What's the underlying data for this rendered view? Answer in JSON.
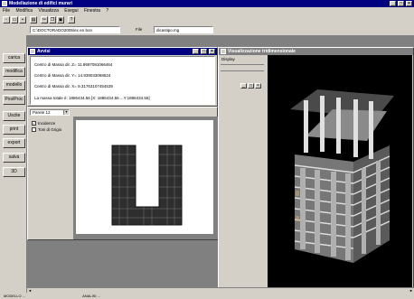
{
  "app": {
    "title": "Modellazione  di edifici murari",
    "menu": [
      "File",
      "Modifica",
      "Visualizza",
      "Esegui",
      "Finestra",
      "?"
    ]
  },
  "toolbar_icons": [
    "new-icon",
    "open-icon",
    "save-icon",
    "print-icon",
    "cut-icon",
    "copy-icon",
    "paste-icon",
    "info-icon"
  ],
  "pathbar": {
    "path_value": "C:\\DOCTORADO2005\\ex en bon",
    "file_label": "File",
    "file_value": "dicastipo.mg"
  },
  "sidebar": {
    "buttons": [
      "carica",
      "modifica",
      "modello",
      "PostProc",
      "Uscite",
      "print",
      "export",
      "salva",
      "3D"
    ]
  },
  "avvisi": {
    "title": "Avvisi",
    "lines": [
      "Centro di Massa dir. Z= 11.8697081066464",
      "Centro di Massa dir. Y= 14.939033068524",
      "Centro di Massa dir. X= 9.31763107454539",
      "La massa totale è: 1886434.56   [X: 1886434.56 ...Y:1886434.56]"
    ]
  },
  "view3d": {
    "title": "Visualizzazione tridimensionale",
    "display_label": "Display"
  },
  "plan": {
    "dropdown_value": "Parete 12",
    "checkboxes": [
      {
        "label": "Incidenze",
        "checked": true
      },
      {
        "label": "Toni di Grigio",
        "checked": false
      }
    ]
  },
  "statusbar": {
    "items": [
      "MODELLO ...",
      "ANALISI ..."
    ]
  }
}
